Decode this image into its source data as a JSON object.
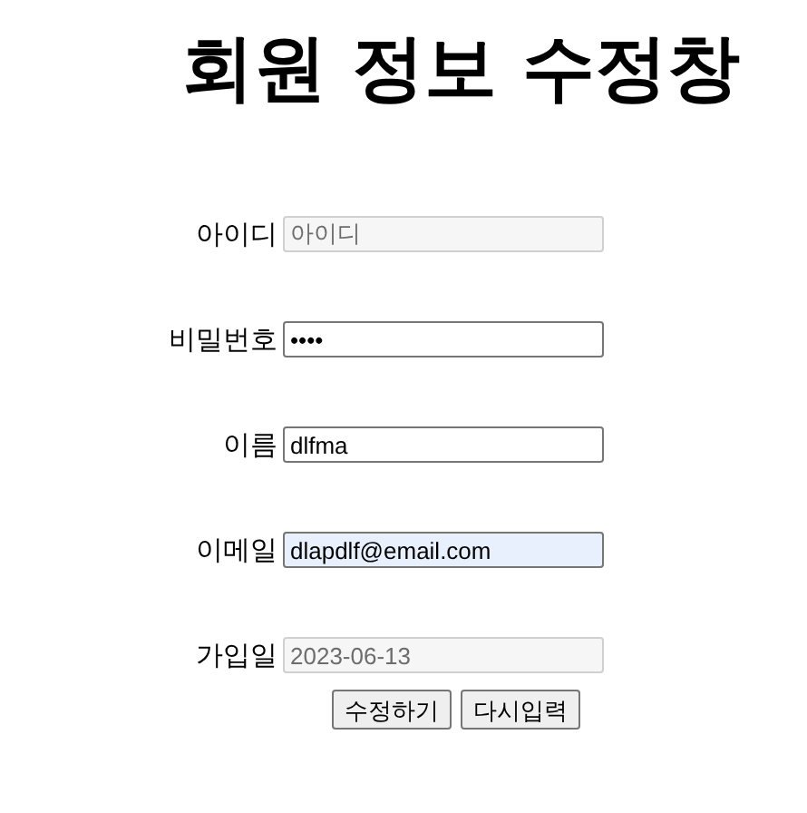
{
  "title": "회원 정보 수정창",
  "fields": [
    {
      "label": "아이디",
      "value": "아이디",
      "disabled": true,
      "autofilled": false
    },
    {
      "label": "비밀번호",
      "value": "••••",
      "disabled": false,
      "autofilled": false
    },
    {
      "label": "이름",
      "value": "dlfma",
      "disabled": false,
      "autofilled": false
    },
    {
      "label": "이메일",
      "value": "dlapdlf@email.com",
      "disabled": false,
      "autofilled": true
    },
    {
      "label": "가입일",
      "value": "2023-06-13",
      "disabled": true,
      "autofilled": false
    }
  ],
  "buttons": [
    "수정하기",
    "다시입력"
  ]
}
